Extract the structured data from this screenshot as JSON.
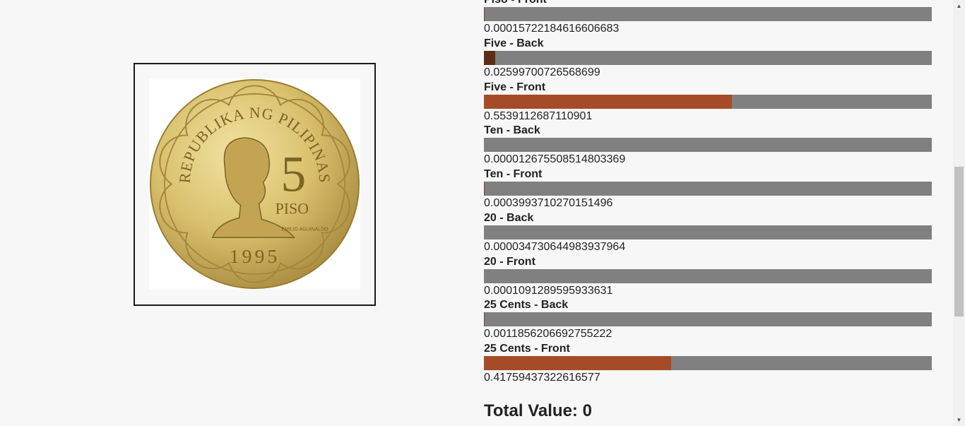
{
  "coin_image": {
    "legend_text": "REPUBLIKA NG PILIPINAS",
    "denomination": "5",
    "unit": "PISO",
    "portrait_name": "EMILIO AGUINALDO",
    "year": "1995"
  },
  "results": [
    {
      "label": "Piso - Front",
      "value": "0.00015722184616606683",
      "score": 0.00015722184616606683,
      "color": "#8b3a1a"
    },
    {
      "label": "Five - Back",
      "value": "0.02599700726568699",
      "score": 0.02599700726568699,
      "color": "#5a2e16"
    },
    {
      "label": "Five - Front",
      "value": "0.5539112687110901",
      "score": 0.5539112687110901,
      "color": "#a64b28"
    },
    {
      "label": "Ten - Back",
      "value": "0.000012675508514803369",
      "score": 1.2675508514803369e-05,
      "color": "#8b3a1a"
    },
    {
      "label": "Ten - Front",
      "value": "0.0003993710270151496",
      "score": 0.0003993710270151496,
      "color": "#8b3a1a"
    },
    {
      "label": "20 - Back",
      "value": "0.000034730644983937964",
      "score": 3.4730644983937964e-05,
      "color": "#8b3a1a"
    },
    {
      "label": "20 - Front",
      "value": "0.0001091289595933631",
      "score": 0.0001091289595933631,
      "color": "#8b3a1a"
    },
    {
      "label": "25 Cents - Back",
      "value": "0.0011856206692755222",
      "score": 0.0011856206692755222,
      "color": "#8b3a1a"
    },
    {
      "label": "25 Cents - Front",
      "value": "0.41759437322616577",
      "score": 0.41759437322616577,
      "color": "#a64b28"
    }
  ],
  "total": {
    "text": "Total Value: 0"
  },
  "colors": {
    "track": "#808080",
    "page_bg": "#f7f7f7"
  }
}
